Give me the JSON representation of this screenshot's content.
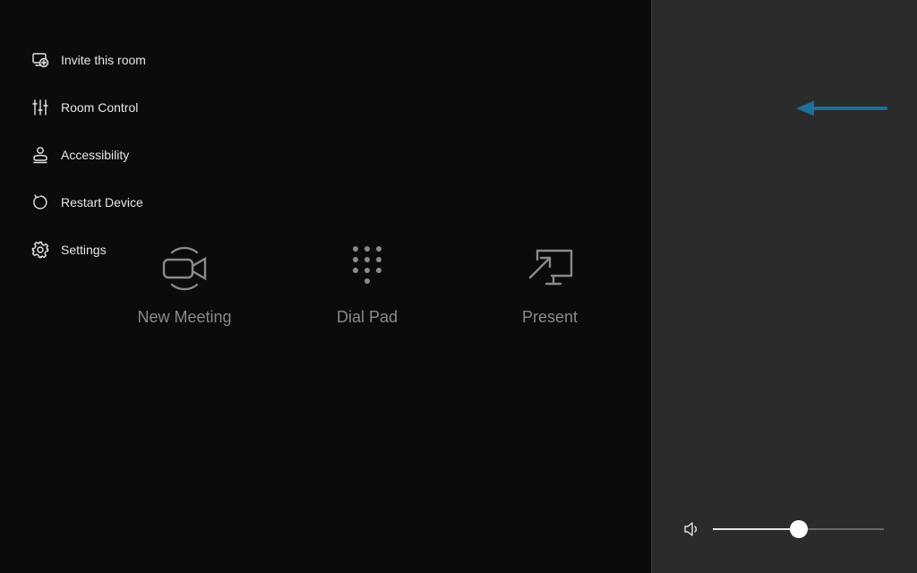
{
  "home": {
    "actions": [
      {
        "label": "New Meeting",
        "icon": "video-camera-icon"
      },
      {
        "label": "Dial Pad",
        "icon": "dial-pad-icon"
      },
      {
        "label": "Present",
        "icon": "present-screen-icon"
      }
    ]
  },
  "side_panel": {
    "items": [
      {
        "label": "Invite this room",
        "icon": "invite-room-icon"
      },
      {
        "label": "Room Control",
        "icon": "sliders-icon"
      },
      {
        "label": "Accessibility",
        "icon": "accessibility-icon"
      },
      {
        "label": "Restart Device",
        "icon": "restart-icon"
      },
      {
        "label": "Settings",
        "icon": "gear-icon"
      }
    ],
    "volume": {
      "icon": "speaker-icon",
      "level_percent": 50
    }
  },
  "annotation": {
    "arrow_color": "#1d6f9e",
    "points_to": "Room Control"
  }
}
